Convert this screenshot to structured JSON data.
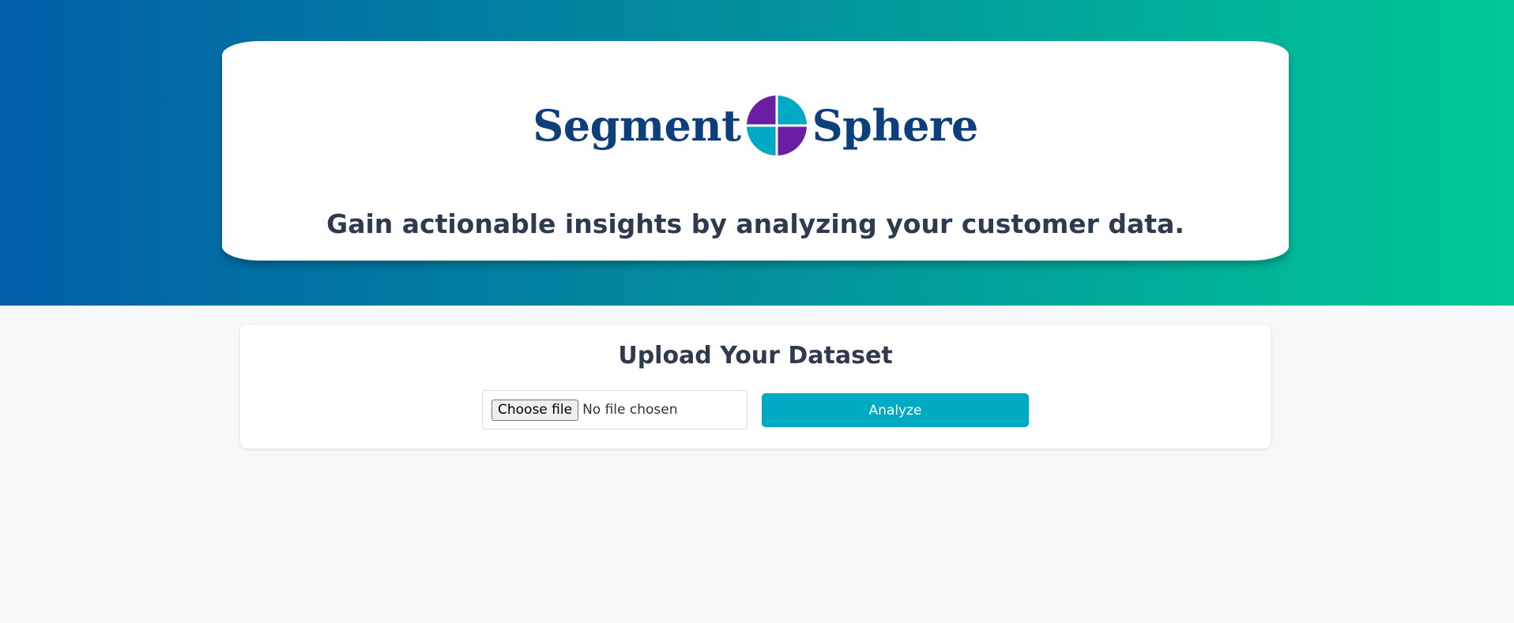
{
  "brand": {
    "name_left": "Segment",
    "name_right": "Sphere",
    "logo_icon": "quartered-circle-icon",
    "colors": {
      "wordmark": "#0c3f7c",
      "purple": "#6a1fa3",
      "teal": "#00a9c6"
    }
  },
  "hero": {
    "tagline": "Gain actionable insights by analyzing your customer data.",
    "gradient": [
      "#015fa8",
      "#00c896"
    ]
  },
  "upload": {
    "title": "Upload Your Dataset",
    "choose_label": "Choose file",
    "file_status": "No file chosen",
    "analyze_label": "Analyze",
    "accent": "#00aac2"
  }
}
